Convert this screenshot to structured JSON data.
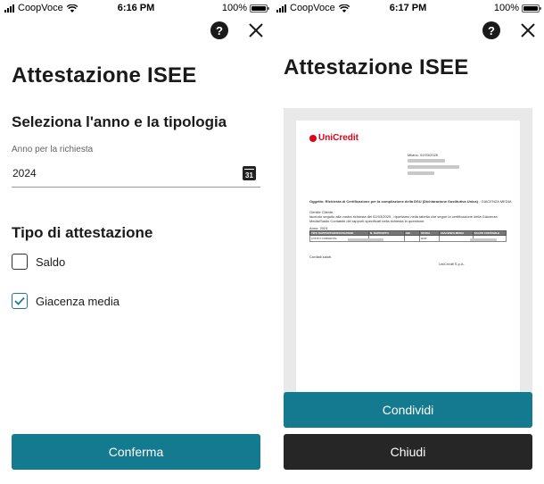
{
  "left_screen": {
    "status": {
      "carrier": "CoopVoce",
      "time": "6:16 PM",
      "battery": "100%"
    },
    "title": "Attestazione ISEE",
    "subtitle": "Seleziona l'anno e la tipologia",
    "year_field": {
      "label": "Anno per la richiesta",
      "value": "2024",
      "calendar_day": "31"
    },
    "type_section": {
      "title": "Tipo di attestazione",
      "options": [
        {
          "label": "Saldo",
          "checked": false
        },
        {
          "label": "Giacenza media",
          "checked": true
        }
      ]
    },
    "confirm_label": "Conferma"
  },
  "right_screen": {
    "status": {
      "carrier": "CoopVoce",
      "time": "6:17 PM",
      "battery": "100%"
    },
    "title": "Attestazione ISEE",
    "document": {
      "logo": "UniCredit",
      "date_line": "Milano, 02/03/2025",
      "subject": "Oggetto: Richiesta di Certificazione per la compilazione della DSU (Dichiarazione Sostitutiva Unica)",
      "subject_tail": "- GIACENZA MEDIA",
      "greeting": "Gentile Cliente,",
      "body_1": "facendo seguito alla vostra richiesta del 02/03/2025 , riportiamo nella tabella che segue la certificazione della Giacenza",
      "body_2": "Media/Saldo Contabile dei rapporti specificati nella richiesta in questione.",
      "year_line": "Anno: 2024",
      "table_headers": [
        "TIPO RAPPORTO/INTESTAZIONE",
        "N. RAPPORTO",
        "ABI",
        "DIVISA",
        "GIACENZA MEDIA",
        "SALDO CONTABILE"
      ],
      "table_row": [
        "CONTO CORRENTE",
        "",
        "",
        "EUR",
        "",
        ""
      ],
      "closing": "Cordiali saluti.",
      "signature": "UniCredit S.p.A."
    },
    "share_label": "Condividi",
    "close_label": "Chiudi"
  }
}
